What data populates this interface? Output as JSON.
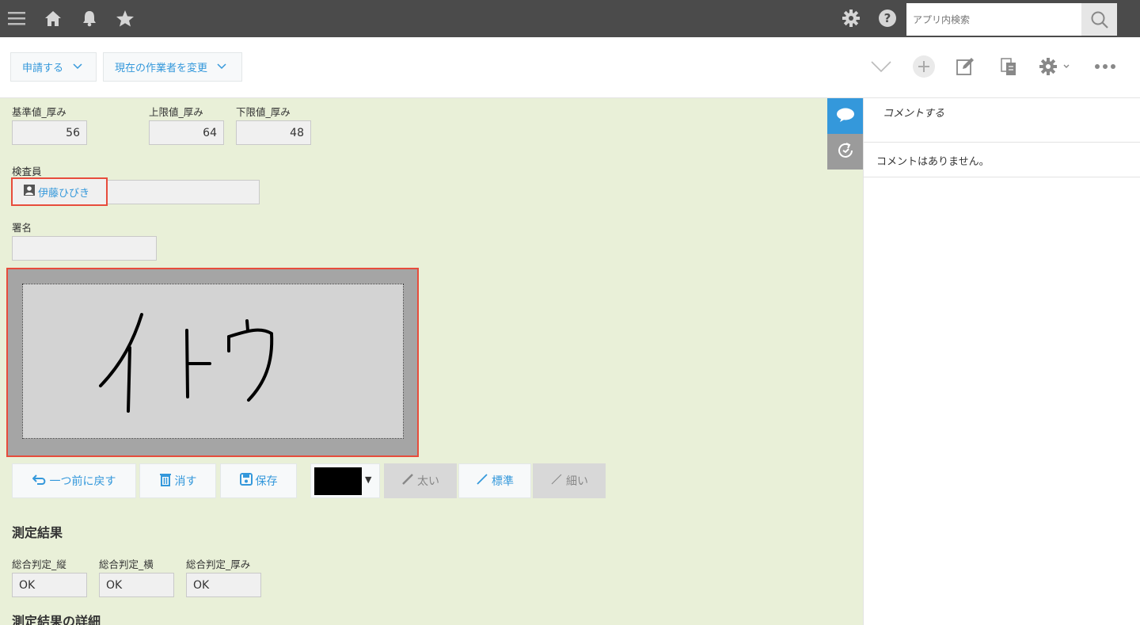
{
  "topbar": {
    "icons": [
      "menu-icon",
      "home-icon",
      "bell-icon",
      "star-icon",
      "gear-icon",
      "help-icon",
      "search-icon"
    ],
    "search_placeholder": "アプリ内検索"
  },
  "actions": {
    "apply_label": "申請する",
    "change_assignee_label": "現在の作業者を変更",
    "right_icons": [
      "chevron-down-icon",
      "add-icon",
      "edit-icon",
      "duplicate-icon",
      "settings-icon",
      "more-icon"
    ]
  },
  "fields": {
    "base_thickness": {
      "label": "基準値_厚み",
      "value": "56"
    },
    "upper_thickness": {
      "label": "上限値_厚み",
      "value": "64"
    },
    "lower_thickness": {
      "label": "下限値_厚み",
      "value": "48"
    },
    "inspector": {
      "label": "検査員",
      "value": "伊藤ひびき"
    },
    "signature": {
      "label": "署名",
      "value": ""
    }
  },
  "signature_pad": {
    "drawn_text": "イトウ",
    "buttons": {
      "undo": "一つ前に戻す",
      "clear": "消す",
      "save": "保存",
      "thick": "太い",
      "normal": "標準",
      "thin": "細い"
    },
    "pen_color": "#000000",
    "selected_width": "標準"
  },
  "results": {
    "title": "測定結果",
    "overall_length": {
      "label": "総合判定_縦",
      "value": "OK"
    },
    "overall_width": {
      "label": "総合判定_横",
      "value": "OK"
    },
    "overall_thickness": {
      "label": "総合判定_厚み",
      "value": "OK"
    }
  },
  "details_title": "測定結果の詳細",
  "side_panel": {
    "comment_prompt": "コメントする",
    "no_comments": "コメントはありません。"
  },
  "colors": {
    "topbar": "#4b4b4b",
    "record_bg": "#e9f0d8",
    "accent": "#3498db",
    "highlight": "#e74c3c"
  }
}
